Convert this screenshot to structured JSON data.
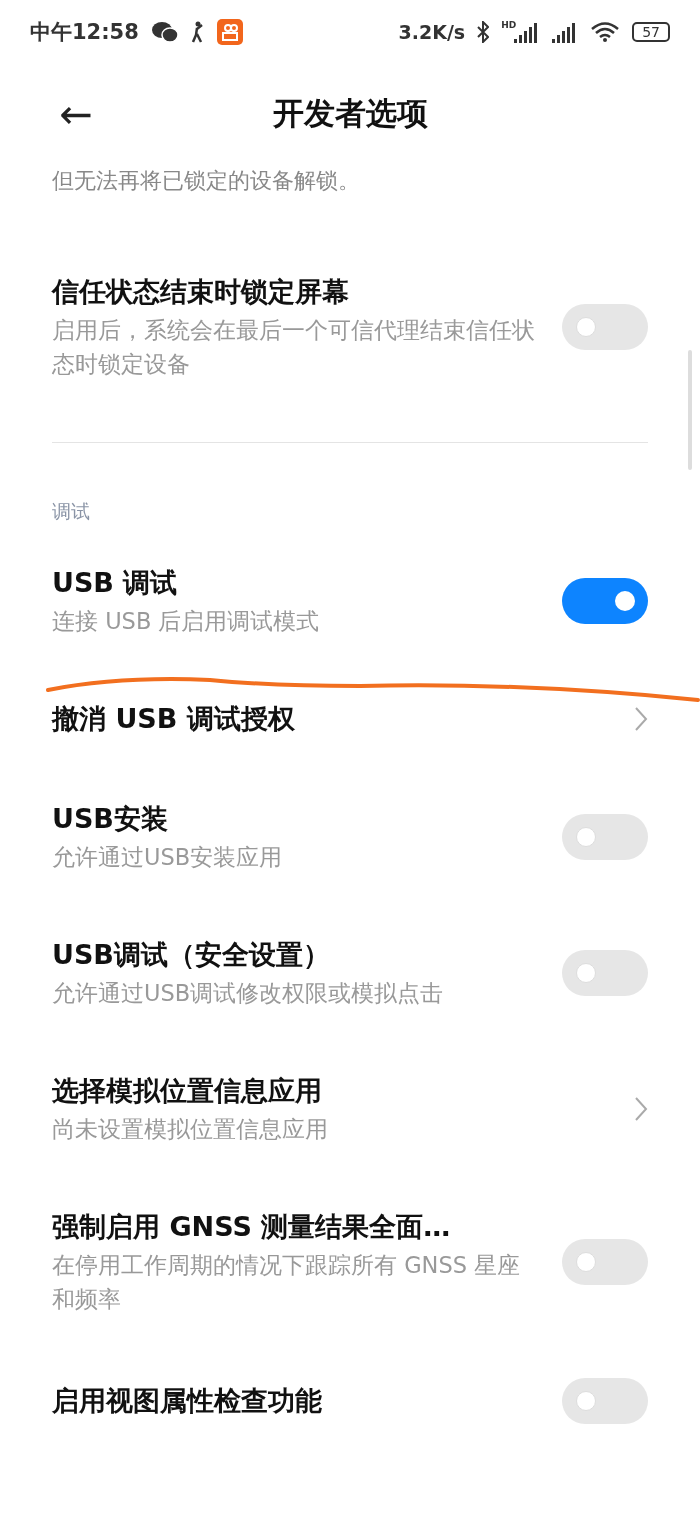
{
  "status_bar": {
    "time": "中午12:58",
    "speed": "3.2K/s",
    "signal_badge": "HD",
    "battery": "57"
  },
  "header": {
    "back": "←",
    "title": "开发者选项"
  },
  "items": [
    {
      "kind": "fragment",
      "description": "但无法再将已锁定的设备解锁。"
    },
    {
      "kind": "toggle",
      "title": "信任状态结束时锁定屏幕",
      "description": "启用后，系统会在最后一个可信代理结束信任状态时锁定设备",
      "on": false
    },
    {
      "kind": "divider"
    },
    {
      "kind": "section",
      "title": "调试"
    },
    {
      "kind": "toggle",
      "title": "USB 调试",
      "description": "连接 USB 后启用调试模式",
      "on": true
    },
    {
      "kind": "link",
      "title": "撤消 USB 调试授权"
    },
    {
      "kind": "toggle",
      "title": "USB安装",
      "description": "允许通过USB安装应用",
      "on": false
    },
    {
      "kind": "toggle",
      "title": "USB调试（安全设置）",
      "description": "允许通过USB调试修改权限或模拟点击",
      "on": false
    },
    {
      "kind": "link",
      "title": "选择模拟位置信息应用",
      "description": "尚未设置模拟位置信息应用"
    },
    {
      "kind": "toggle",
      "title": "强制启用 GNSS 测量结果全面…",
      "description": "在停用工作周期的情况下跟踪所有 GNSS 星座和频率",
      "on": false
    },
    {
      "kind": "toggle",
      "title": "启用视图属性检查功能",
      "on": false
    }
  ]
}
